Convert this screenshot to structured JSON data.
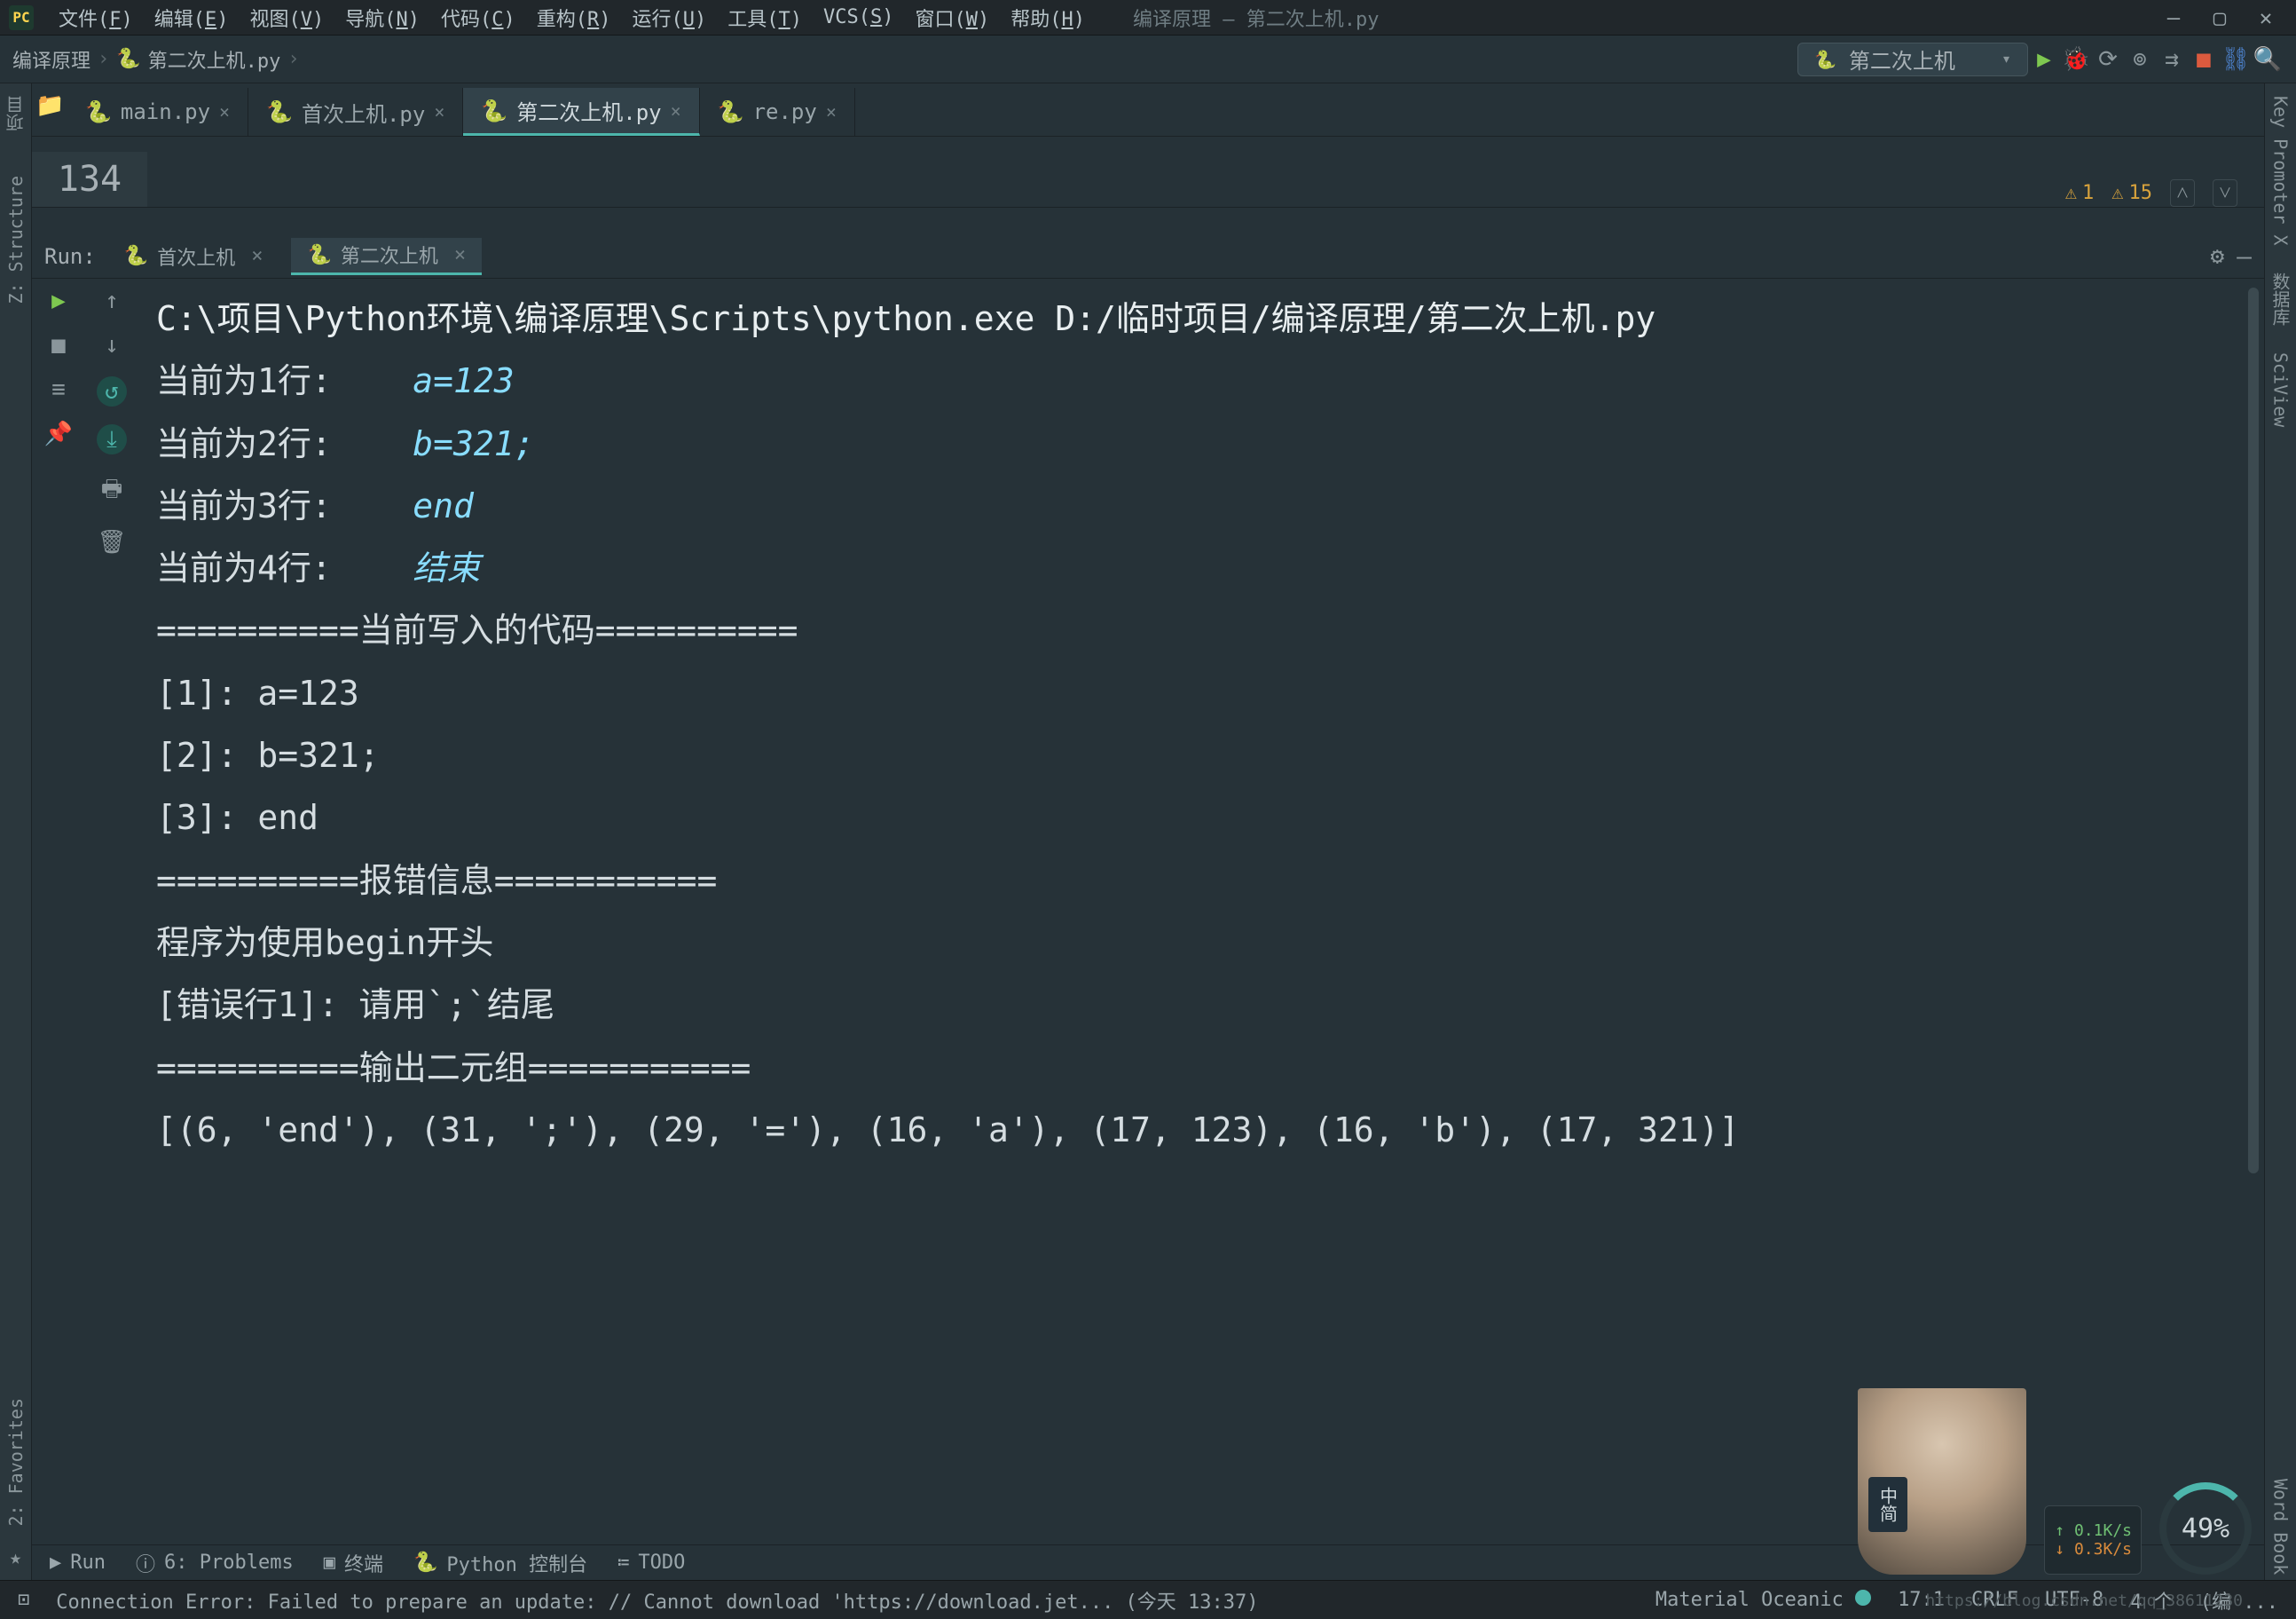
{
  "menubar": {
    "items": [
      {
        "label": "文件(",
        "u": "F",
        "tail": ")"
      },
      {
        "label": "编辑(",
        "u": "E",
        "tail": ")"
      },
      {
        "label": "视图(",
        "u": "V",
        "tail": ")"
      },
      {
        "label": "导航(",
        "u": "N",
        "tail": ")"
      },
      {
        "label": "代码(",
        "u": "C",
        "tail": ")"
      },
      {
        "label": "重构(",
        "u": "R",
        "tail": ")"
      },
      {
        "label": "运行(",
        "u": "U",
        "tail": ")"
      },
      {
        "label": "工具(",
        "u": "T",
        "tail": ")"
      },
      {
        "label": "VCS(",
        "u": "S",
        "tail": ")"
      },
      {
        "label": "窗口(",
        "u": "W",
        "tail": ")"
      },
      {
        "label": "帮助(",
        "u": "H",
        "tail": ")"
      }
    ],
    "title": "编译原理 – 第二次上机.py"
  },
  "breadcrumb": {
    "parts": [
      "编译原理",
      "第二次上机.py"
    ],
    "sep": "›"
  },
  "run_combo": {
    "selected": "第二次上机"
  },
  "editor": {
    "tabs": [
      {
        "file": "main.py",
        "active": false
      },
      {
        "file": "首次上机.py",
        "active": false
      },
      {
        "file": "第二次上机.py",
        "active": true
      },
      {
        "file": "re.py",
        "active": false
      }
    ],
    "gutter": "134",
    "warnings": [
      {
        "count": "1"
      },
      {
        "count": "15"
      }
    ]
  },
  "left_stripe": {
    "tabs": [
      "项目",
      "Z: Structure",
      "2: Favorites"
    ]
  },
  "right_stripe": {
    "tabs": [
      "Key Promoter X",
      "数据库",
      "SciView",
      "Word Book"
    ]
  },
  "run_panel": {
    "label": "Run:",
    "tabs": [
      {
        "name": "首次上机",
        "active": false
      },
      {
        "name": "第二次上机",
        "active": true
      }
    ]
  },
  "console": {
    "cmd": "C:\\项目\\Python环境\\编译原理\\Scripts\\python.exe D:/临时项目/编译原理/第二次上机.py",
    "lines": [
      {
        "label": "当前为1行:",
        "val": "a=123",
        "ital": true
      },
      {
        "label": "当前为2行:",
        "val": "b=321;",
        "ital": true
      },
      {
        "label": "当前为3行:",
        "val": "end",
        "ital": true
      },
      {
        "label": "当前为4行:",
        "val": "结束",
        "ital": true
      }
    ],
    "sep1": "==========当前写入的代码==========",
    "block2": [
      "[1]: a=123",
      "[2]: b=321;",
      "[3]: end"
    ],
    "sep2": "==========报错信息===========",
    "err1": "程序为使用begin开头",
    "err2": "[错误行1]: 请用`;`结尾",
    "sep3": "==========输出二元组===========",
    "tuples": "[(6, 'end'), (31, ';'), (29, '='), (16, 'a'), (17, 123), (16, 'b'), (17, 321)]"
  },
  "bottom_tools": {
    "run": "Run",
    "problems": "6: Problems",
    "terminal": "终端",
    "pyconsole": "Python 控制台",
    "todo": "TODO"
  },
  "statusbar": {
    "msg": "Connection Error: Failed to prepare an update: // Cannot download 'https://download.jet... (今天 13:37)",
    "theme": "Material Oceanic",
    "pos": "17:1",
    "eol": "CRLF",
    "enc": "UTF-8",
    "indent": "4 个",
    "branch": "(编 ..."
  },
  "floating": {
    "up": "↑ 0.1K/s",
    "down": "↓ 0.3K/s",
    "cpu": "49%",
    "lang": "中简"
  },
  "watermark": "https://blog.csdn.net/qq_38611230"
}
